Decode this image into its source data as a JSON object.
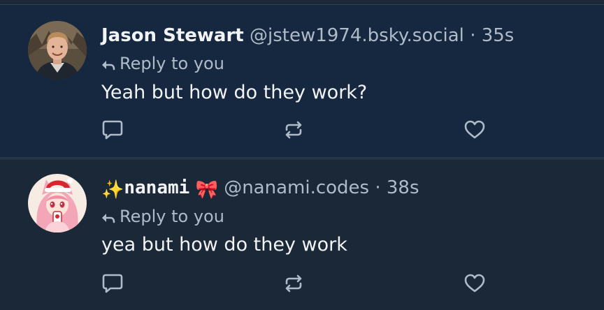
{
  "posts": [
    {
      "display_name": "Jason Stewart",
      "handle": "@jstew1974.bsky.social",
      "separator": "·",
      "time": "35s",
      "reply_label": "Reply to you",
      "text": "Yeah but how do they work?",
      "avatar_icon": "profile-photo-man",
      "actions": [
        "comment-icon",
        "repost-icon",
        "like-icon"
      ]
    },
    {
      "display_name_prefix": "✨",
      "display_name": "nanami",
      "display_name_suffix": "🎀",
      "handle": "@nanami.codes",
      "separator": "·",
      "time": "38s",
      "reply_label": "Reply to you",
      "text": "yea but how do they work",
      "avatar_icon": "anime-avatar-pink-hair",
      "actions": [
        "comment-icon",
        "repost-icon",
        "like-icon"
      ]
    }
  ],
  "colors": {
    "background": "#1b2838",
    "highlight_background": "#162840",
    "text_primary": "#f1f3f5",
    "text_secondary": "#aebbc9",
    "border": "#2e4052"
  }
}
